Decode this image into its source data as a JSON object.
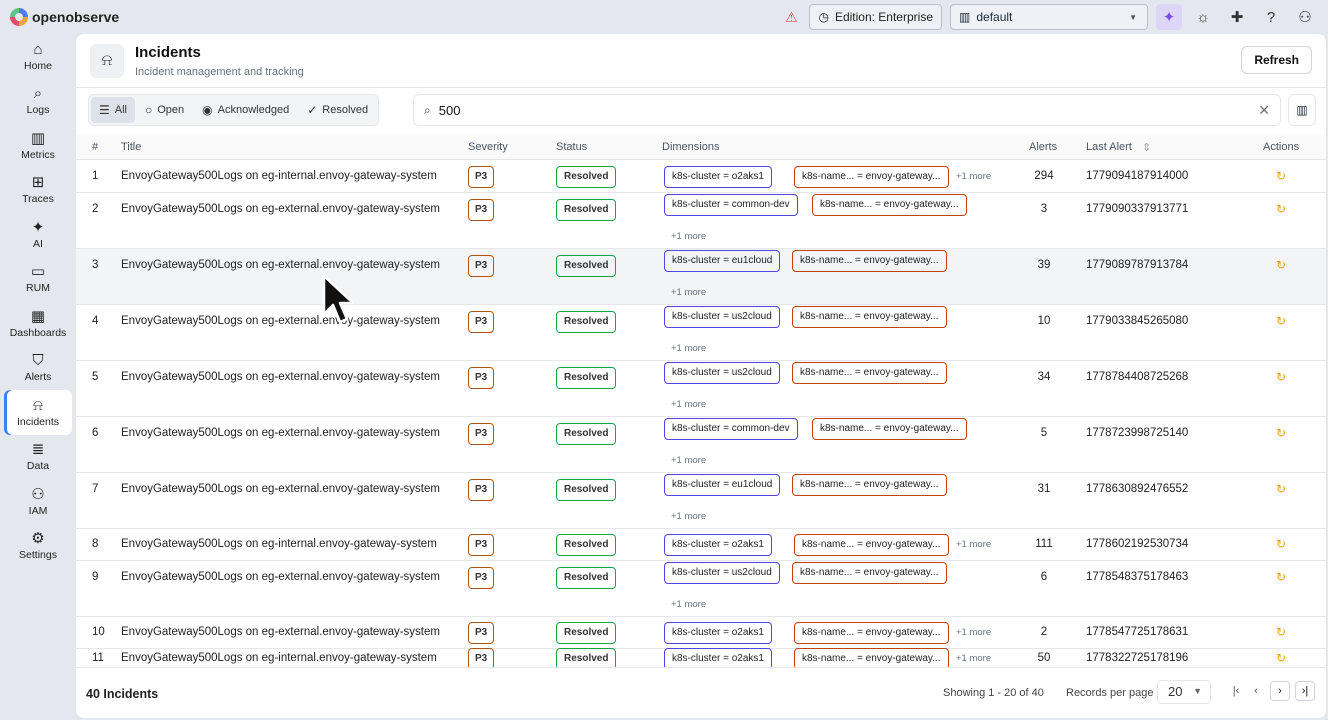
{
  "app": {
    "name": "openobserve"
  },
  "topbar": {
    "edition": "Edition: Enterprise",
    "org": "default"
  },
  "sidebar": {
    "items": [
      {
        "label": "Home",
        "icon": "home-icon",
        "glyph": "⌂"
      },
      {
        "label": "Logs",
        "icon": "search-icon",
        "glyph": "⌕"
      },
      {
        "label": "Metrics",
        "icon": "bar-chart-icon",
        "glyph": "▥"
      },
      {
        "label": "Traces",
        "icon": "traces-icon",
        "glyph": "⊞"
      },
      {
        "label": "AI",
        "icon": "sparkle-icon",
        "glyph": "✦"
      },
      {
        "label": "RUM",
        "icon": "monitor-icon",
        "glyph": "▭"
      },
      {
        "label": "Dashboards",
        "icon": "dashboard-icon",
        "glyph": "▦"
      },
      {
        "label": "Alerts",
        "icon": "shield-icon",
        "glyph": "⛉"
      },
      {
        "label": "Incidents",
        "icon": "bell-icon",
        "glyph": "⍾"
      },
      {
        "label": "Data",
        "icon": "database-icon",
        "glyph": "≣"
      },
      {
        "label": "IAM",
        "icon": "users-icon",
        "glyph": "⚇"
      },
      {
        "label": "Settings",
        "icon": "gear-icon",
        "glyph": "⚙"
      }
    ],
    "active": "Incidents"
  },
  "page": {
    "title": "Incidents",
    "subtitle": "Incident management and tracking",
    "refresh": "Refresh"
  },
  "filters": [
    {
      "label": "All",
      "icon": "list-icon",
      "glyph": "☰",
      "selected": true
    },
    {
      "label": "Open",
      "icon": "circle-icon",
      "glyph": "○",
      "selected": false
    },
    {
      "label": "Acknowledged",
      "icon": "eye-icon",
      "glyph": "◉",
      "selected": false
    },
    {
      "label": "Resolved",
      "icon": "check-circle-icon",
      "glyph": "✓",
      "selected": false
    }
  ],
  "search": {
    "value": "500"
  },
  "table": {
    "columns": {
      "num": "#",
      "title": "Title",
      "severity": "Severity",
      "status": "Status",
      "dimensions": "Dimensions",
      "alerts": "Alerts",
      "last_alert": "Last Alert",
      "actions": "Actions"
    },
    "rows": [
      {
        "num": "1",
        "title": "EnvoyGateway500Logs on eg-internal.envoy-gateway-system",
        "severity": "P3",
        "status": "Resolved",
        "cluster": "k8s-cluster = o2aks1",
        "name": "k8s-name... = envoy-gateway...",
        "more": "+1 more",
        "inline": true,
        "alerts": "294",
        "last": "1779094187914000"
      },
      {
        "num": "2",
        "title": "EnvoyGateway500Logs on eg-external.envoy-gateway-system",
        "severity": "P3",
        "status": "Resolved",
        "cluster": "k8s-cluster = common-dev",
        "name": "k8s-name... = envoy-gateway...",
        "more": "+1 more",
        "inline": false,
        "alerts": "3",
        "last": "1779090337913771"
      },
      {
        "num": "3",
        "title": "EnvoyGateway500Logs on eg-external.envoy-gateway-system",
        "severity": "P3",
        "status": "Resolved",
        "cluster": "k8s-cluster = eu1cloud",
        "name": "k8s-name... = envoy-gateway...",
        "more": "+1 more",
        "inline": false,
        "alerts": "39",
        "last": "1779089787913784"
      },
      {
        "num": "4",
        "title": "EnvoyGateway500Logs on eg-external.envoy-gateway-system",
        "severity": "P3",
        "status": "Resolved",
        "cluster": "k8s-cluster = us2cloud",
        "name": "k8s-name... = envoy-gateway...",
        "more": "+1 more",
        "inline": false,
        "alerts": "10",
        "last": "1779033845265080"
      },
      {
        "num": "5",
        "title": "EnvoyGateway500Logs on eg-external.envoy-gateway-system",
        "severity": "P3",
        "status": "Resolved",
        "cluster": "k8s-cluster = us2cloud",
        "name": "k8s-name... = envoy-gateway...",
        "more": "+1 more",
        "inline": false,
        "alerts": "34",
        "last": "1778784408725268"
      },
      {
        "num": "6",
        "title": "EnvoyGateway500Logs on eg-external.envoy-gateway-system",
        "severity": "P3",
        "status": "Resolved",
        "cluster": "k8s-cluster = common-dev",
        "name": "k8s-name... = envoy-gateway...",
        "more": "+1 more",
        "inline": false,
        "alerts": "5",
        "last": "1778723998725140"
      },
      {
        "num": "7",
        "title": "EnvoyGateway500Logs on eg-external.envoy-gateway-system",
        "severity": "P3",
        "status": "Resolved",
        "cluster": "k8s-cluster = eu1cloud",
        "name": "k8s-name... = envoy-gateway...",
        "more": "+1 more",
        "inline": false,
        "alerts": "31",
        "last": "1778630892476552"
      },
      {
        "num": "8",
        "title": "EnvoyGateway500Logs on eg-internal.envoy-gateway-system",
        "severity": "P3",
        "status": "Resolved",
        "cluster": "k8s-cluster = o2aks1",
        "name": "k8s-name... = envoy-gateway...",
        "more": "+1 more",
        "inline": true,
        "alerts": "111",
        "last": "1778602192530734"
      },
      {
        "num": "9",
        "title": "EnvoyGateway500Logs on eg-external.envoy-gateway-system",
        "severity": "P3",
        "status": "Resolved",
        "cluster": "k8s-cluster = us2cloud",
        "name": "k8s-name... = envoy-gateway...",
        "more": "+1 more",
        "inline": false,
        "alerts": "6",
        "last": "1778548375178463"
      },
      {
        "num": "10",
        "title": "EnvoyGateway500Logs on eg-external.envoy-gateway-system",
        "severity": "P3",
        "status": "Resolved",
        "cluster": "k8s-cluster = o2aks1",
        "name": "k8s-name... = envoy-gateway...",
        "more": "+1 more",
        "inline": true,
        "alerts": "2",
        "last": "1778547725178631"
      },
      {
        "num": "11",
        "title": "EnvoyGateway500Logs on eg-internal.envoy-gateway-system",
        "severity": "P3",
        "status": "Resolved",
        "cluster": "k8s-cluster = o2aks1",
        "name": "k8s-name... = envoy-gateway...",
        "more": "+1 more",
        "inline": true,
        "alerts": "50",
        "last": "1778322725178196"
      }
    ]
  },
  "footer": {
    "count": "40 Incidents",
    "showing": "Showing 1 - 20 of 40",
    "records_label": "Records per page",
    "records_value": "20"
  }
}
